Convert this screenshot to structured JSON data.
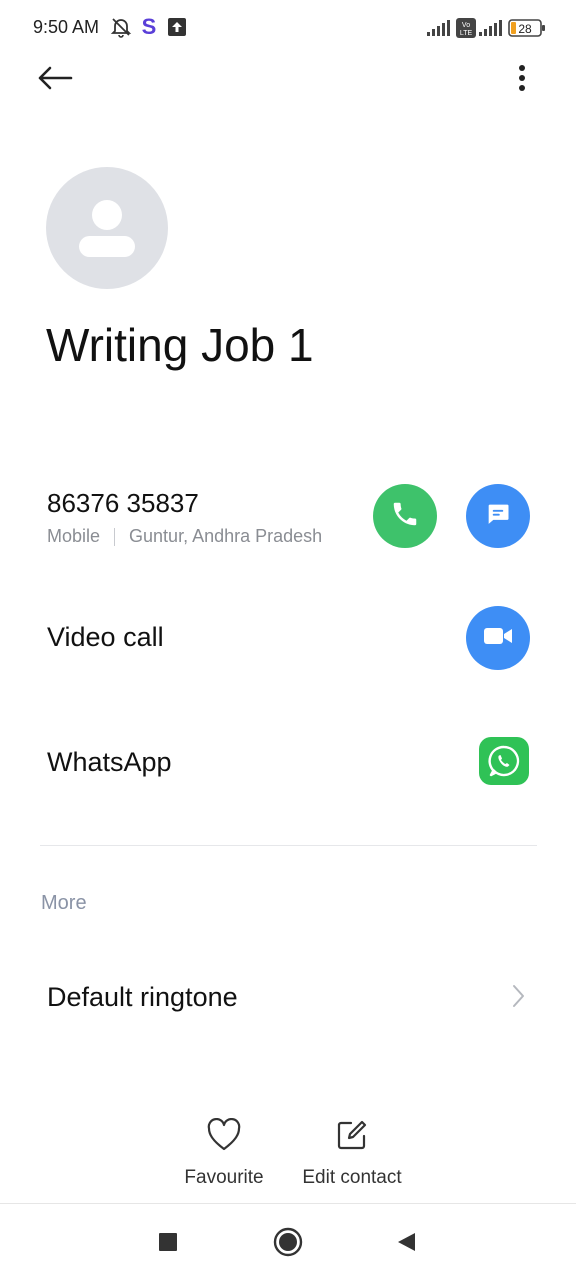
{
  "status_bar": {
    "time": "9:50 AM",
    "battery": "28",
    "icons": [
      "do-not-disturb-icon",
      "s-app-icon",
      "upload-icon",
      "signal-icon",
      "volte-icon",
      "signal-icon",
      "battery-icon"
    ]
  },
  "toolbar": {
    "back_icon": "back-arrow-icon",
    "more_icon": "more-vertical-icon"
  },
  "contact": {
    "name": "Writing Job 1",
    "phone": {
      "number": "86376 35837",
      "type": "Mobile",
      "location": "Guntur, Andhra Pradesh"
    }
  },
  "rows": {
    "video_call": "Video call",
    "whatsapp": "WhatsApp",
    "more_header": "More",
    "default_ringtone": "Default ringtone"
  },
  "actions": {
    "favourite": "Favourite",
    "edit_contact": "Edit contact"
  },
  "colors": {
    "call_green": "#3ec26b",
    "action_blue": "#3e8ef5",
    "whatsapp_green": "#2fc256",
    "avatar_gray": "#dfe1e6"
  }
}
